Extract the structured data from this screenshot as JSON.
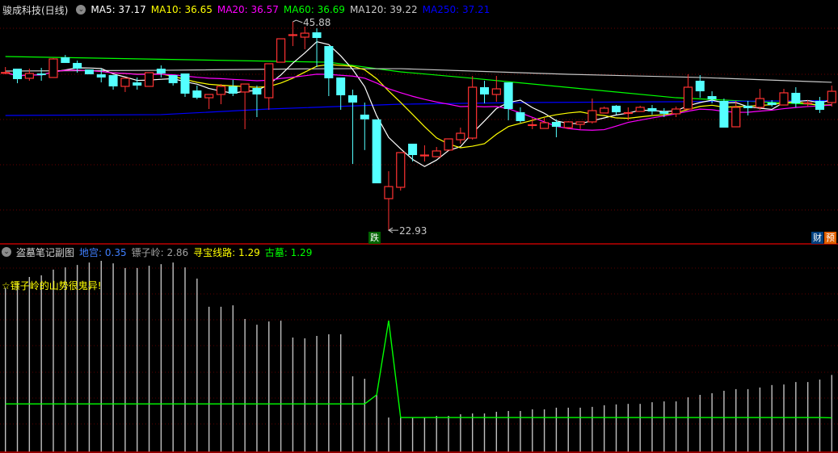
{
  "header": {
    "title": "骏成科技(日线)",
    "ma": [
      {
        "label": "MA5: 37.17",
        "color": "#ffffff"
      },
      {
        "label": "MA10: 36.65",
        "color": "#ffff00"
      },
      {
        "label": "MA20: 36.57",
        "color": "#ff00ff"
      },
      {
        "label": "MA60: 36.69",
        "color": "#00ff00"
      },
      {
        "label": "MA120: 39.22",
        "color": "#c8c8c8"
      },
      {
        "label": "MA250: 37.21",
        "color": "#0000ff"
      }
    ]
  },
  "markers": {
    "high_label": "45.88",
    "low_label": "22.93",
    "fall_badge": "跌",
    "finance_badge": "财",
    "forecast_badge": "预"
  },
  "sub": {
    "title": "盗墓笔记副图",
    "indicators": [
      {
        "label": "地宫: 0.35",
        "color": "#3f7fff"
      },
      {
        "label": "镖子岭: 2.86",
        "color": "#a0a0a0"
      },
      {
        "label": "寻宝线路: 1.29",
        "color": "#ffff00"
      },
      {
        "label": "古墓: 1.29",
        "color": "#00ff00"
      }
    ],
    "annotation": "☆镖子岭的山势很鬼异!"
  },
  "chart_data": [
    {
      "type": "candlestick",
      "title": "骏成科技(日线)",
      "ylim": [
        22.0,
        47.0
      ],
      "grid": true,
      "up_color": "#ff3232",
      "down_color": "#54ffff",
      "ohlc": [
        [
          40.24,
          40.9,
          40.1,
          40.3
        ],
        [
          40.72,
          40.72,
          39.12,
          39.57
        ],
        [
          39.66,
          40.72,
          39.39,
          40.19
        ],
        [
          40.19,
          40.81,
          39.39,
          40.01
        ],
        [
          39.75,
          41.88,
          39.75,
          41.79
        ],
        [
          41.97,
          42.23,
          41.35,
          41.35
        ],
        [
          41.35,
          41.61,
          40.28,
          40.72
        ],
        [
          40.63,
          40.63,
          40.1,
          40.1
        ],
        [
          40.1,
          40.72,
          39.21,
          39.75
        ],
        [
          40.01,
          40.01,
          38.41,
          38.77
        ],
        [
          38.77,
          39.66,
          38.15,
          39.66
        ],
        [
          39.21,
          39.75,
          38.41,
          38.86
        ],
        [
          38.77,
          40.28,
          38.77,
          40.28
        ],
        [
          40.72,
          41.08,
          39.75,
          40.19
        ],
        [
          40.01,
          40.01,
          38.86,
          39.12
        ],
        [
          40.19,
          40.19,
          37.61,
          37.97
        ],
        [
          38.32,
          38.86,
          37.35,
          37.52
        ],
        [
          37.52,
          37.88,
          36.28,
          37.88
        ],
        [
          37.88,
          39.03,
          36.81,
          38.77
        ],
        [
          38.77,
          39.48,
          37.7,
          37.97
        ],
        [
          38.15,
          39.03,
          34.06,
          39.03
        ],
        [
          38.59,
          38.86,
          35.39,
          37.88
        ],
        [
          37.52,
          41.26,
          36.19,
          41.26
        ],
        [
          41.43,
          44.01,
          41.43,
          44.01
        ],
        [
          44.4,
          45.88,
          43.21,
          44.46
        ],
        [
          44.19,
          45.35,
          42.86,
          44.63
        ],
        [
          44.72,
          45.17,
          40.9,
          44.1
        ],
        [
          43.21,
          43.21,
          37.7,
          39.66
        ],
        [
          39.75,
          39.75,
          36.19,
          37.79
        ],
        [
          37.79,
          38.41,
          30.23,
          36.99
        ],
        [
          35.66,
          36.99,
          31.76,
          35.14
        ],
        [
          35.14,
          35.14,
          28.1,
          28.1
        ],
        [
          26.41,
          29.43,
          22.93,
          27.74
        ],
        [
          27.66,
          31.48,
          27.3,
          31.48
        ],
        [
          32.46,
          32.46,
          30.5,
          31.21
        ],
        [
          31.12,
          32.28,
          30.5,
          31.21
        ],
        [
          31.03,
          32.1,
          31.03,
          31.66
        ],
        [
          31.76,
          32.99,
          31.76,
          32.99
        ],
        [
          32.9,
          34.23,
          32.46,
          33.61
        ],
        [
          33.08,
          39.92,
          32.9,
          38.68
        ],
        [
          38.68,
          39.39,
          36.9,
          37.88
        ],
        [
          37.88,
          39.92,
          37.08,
          38.5
        ],
        [
          39.21,
          39.21,
          35.04,
          36.28
        ],
        [
          35.92,
          36.46,
          34.77,
          34.95
        ],
        [
          34.5,
          35.3,
          34.06,
          34.55
        ],
        [
          34.14,
          35.3,
          34.14,
          34.77
        ],
        [
          34.86,
          35.14,
          33.17,
          34.32
        ],
        [
          34.23,
          34.95,
          34.06,
          34.86
        ],
        [
          34.59,
          34.86,
          34.06,
          34.86
        ],
        [
          34.86,
          37.43,
          34.68,
          36.1
        ],
        [
          35.84,
          36.55,
          35.84,
          36.37
        ],
        [
          36.64,
          36.72,
          35.66,
          35.92
        ],
        [
          35.84,
          36.46,
          35.04,
          35.88
        ],
        [
          36.01,
          36.64,
          36.01,
          36.46
        ],
        [
          36.37,
          36.72,
          35.66,
          36.01
        ],
        [
          36.01,
          36.37,
          35.39,
          35.75
        ],
        [
          35.75,
          36.55,
          35.39,
          36.28
        ],
        [
          36.28,
          40.1,
          36.28,
          38.68
        ],
        [
          39.39,
          40.01,
          37.52,
          38.23
        ],
        [
          37.7,
          38.23,
          36.9,
          37.35
        ],
        [
          37.17,
          37.43,
          34.23,
          34.23
        ],
        [
          34.32,
          37.17,
          34.32,
          36.46
        ],
        [
          36.64,
          37.17,
          35.57,
          36.37
        ],
        [
          36.46,
          38.5,
          36.19,
          37.43
        ],
        [
          36.99,
          37.26,
          36.55,
          36.72
        ],
        [
          36.72,
          38.5,
          36.72,
          38.06
        ],
        [
          38.06,
          38.68,
          36.46,
          36.9
        ],
        [
          36.9,
          37.26,
          36.55,
          36.95
        ],
        [
          37.17,
          37.61,
          35.84,
          36.19
        ],
        [
          36.99,
          38.86,
          36.55,
          38.23
        ]
      ],
      "computed_ma": [
        {
          "name": "MA5",
          "period": 5,
          "color": "#ffffff"
        },
        {
          "name": "MA10",
          "period": 10,
          "color": "#ffff00"
        },
        {
          "name": "MA20",
          "period": 20,
          "color": "#ff00ff"
        }
      ],
      "anchored_ma": [
        {
          "name": "MA60",
          "color": "#00ff00",
          "points": [
            [
              0,
              42.06
            ],
            [
              27,
              41.43
            ],
            [
              33,
              40.37
            ],
            [
              39,
              39.66
            ],
            [
              56,
              37.52
            ],
            [
              69,
              36.69
            ]
          ]
        },
        {
          "name": "MA120",
          "color": "#c8c8c8",
          "points": [
            [
              0,
              40.46
            ],
            [
              13,
              40.54
            ],
            [
              27,
              40.72
            ],
            [
              33,
              40.72
            ],
            [
              47,
              40.1
            ],
            [
              58,
              39.75
            ],
            [
              69,
              39.22
            ]
          ]
        },
        {
          "name": "MA250",
          "color": "#0000ff",
          "points": [
            [
              0,
              35.57
            ],
            [
              13,
              35.66
            ],
            [
              22,
              36.28
            ],
            [
              33,
              36.81
            ],
            [
              43,
              36.99
            ],
            [
              56,
              37.08
            ],
            [
              69,
              37.21
            ]
          ]
        }
      ],
      "high": {
        "index": 24,
        "value": 45.88
      },
      "low": {
        "index": 32,
        "value": 22.93
      }
    },
    {
      "type": "bar+line",
      "title": "盗墓笔记副图",
      "ylim": [
        0,
        7.5
      ],
      "bars_name": "镖子岭",
      "bars": [
        6.04,
        6.24,
        6.45,
        6.51,
        6.72,
        6.8,
        6.89,
        6.98,
        7.04,
        6.95,
        6.78,
        6.78,
        6.86,
        6.92,
        6.98,
        6.8,
        6.39,
        5.36,
        5.36,
        5.41,
        4.91,
        4.7,
        4.82,
        4.85,
        4.23,
        4.2,
        4.29,
        4.35,
        4.35,
        2.81,
        2.72,
        2.13,
        1.3,
        1.3,
        1.3,
        1.3,
        1.36,
        1.36,
        1.42,
        1.45,
        1.45,
        1.51,
        1.54,
        1.54,
        1.6,
        1.6,
        1.66,
        1.66,
        1.66,
        1.69,
        1.75,
        1.78,
        1.8,
        1.8,
        1.86,
        1.89,
        1.89,
        2.04,
        2.13,
        2.19,
        2.28,
        2.34,
        2.34,
        2.4,
        2.49,
        2.51,
        2.6,
        2.6,
        2.69,
        2.86
      ],
      "line_name": "古墓",
      "line": [
        1.8,
        1.8,
        1.8,
        1.8,
        1.8,
        1.8,
        1.8,
        1.8,
        1.8,
        1.8,
        1.8,
        1.8,
        1.8,
        1.8,
        1.8,
        1.8,
        1.8,
        1.8,
        1.8,
        1.8,
        1.8,
        1.8,
        1.8,
        1.8,
        1.8,
        1.8,
        1.8,
        1.8,
        1.8,
        1.8,
        1.8,
        2.13,
        4.85,
        1.3,
        1.3,
        1.3,
        1.3,
        1.3,
        1.3,
        1.3,
        1.3,
        1.3,
        1.3,
        1.3,
        1.3,
        1.3,
        1.3,
        1.3,
        1.3,
        1.3,
        1.3,
        1.3,
        1.3,
        1.3,
        1.3,
        1.3,
        1.3,
        1.3,
        1.3,
        1.3,
        1.3,
        1.3,
        1.3,
        1.3,
        1.3,
        1.3,
        1.3,
        1.3,
        1.3,
        1.29
      ]
    }
  ]
}
